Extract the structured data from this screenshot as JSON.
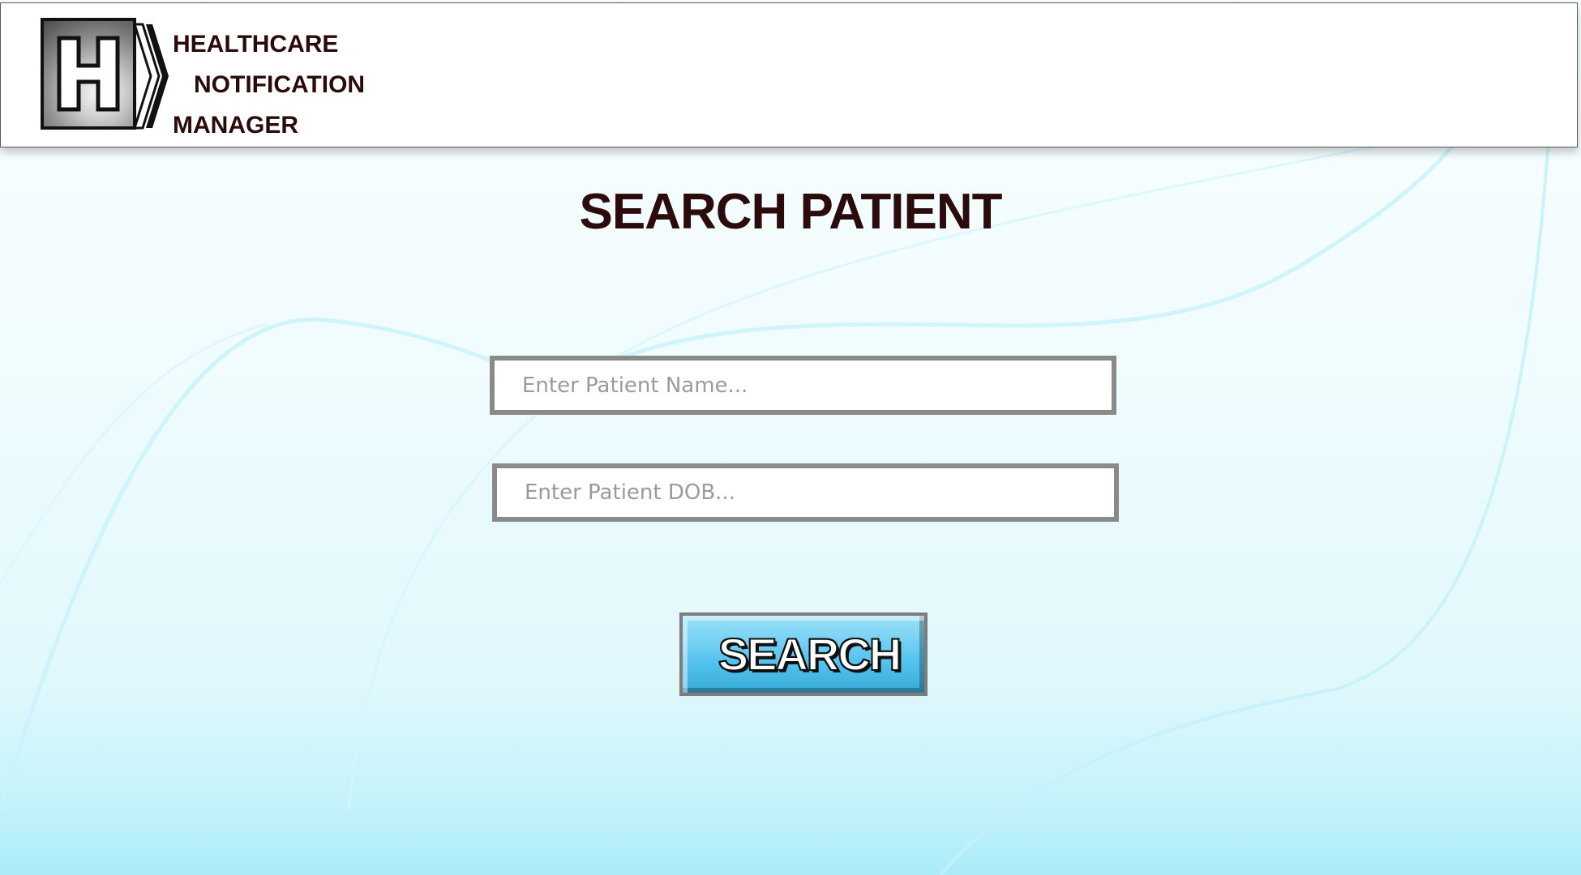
{
  "app": {
    "logo_letter": "H",
    "logo_lines": [
      "HEALTHCARE",
      "NOTIFICATION",
      "MANAGER"
    ]
  },
  "page": {
    "title": "SEARCH PATIENT"
  },
  "form": {
    "name_placeholder": "Enter Patient Name...",
    "dob_placeholder": "Enter Patient DOB...",
    "search_label": "SEARCH"
  },
  "colors": {
    "title_text": "#2b0b0b",
    "button_fill": "#4fc0ec",
    "field_border": "#8a8a8a"
  }
}
